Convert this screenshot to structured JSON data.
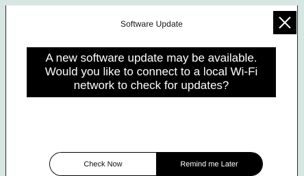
{
  "dialog": {
    "title": "Software Update",
    "close_icon": "close-icon",
    "message_lines": [
      "A new software update may be available.",
      "Would you like to connect to a local Wi-Fi",
      "network to check for updates?"
    ]
  },
  "buttons": {
    "check_now": "Check Now",
    "remind_later": "Remind me Later"
  },
  "colors": {
    "background": "#d6e6e2",
    "dialog": "#ffffff",
    "accent": "#000000"
  }
}
